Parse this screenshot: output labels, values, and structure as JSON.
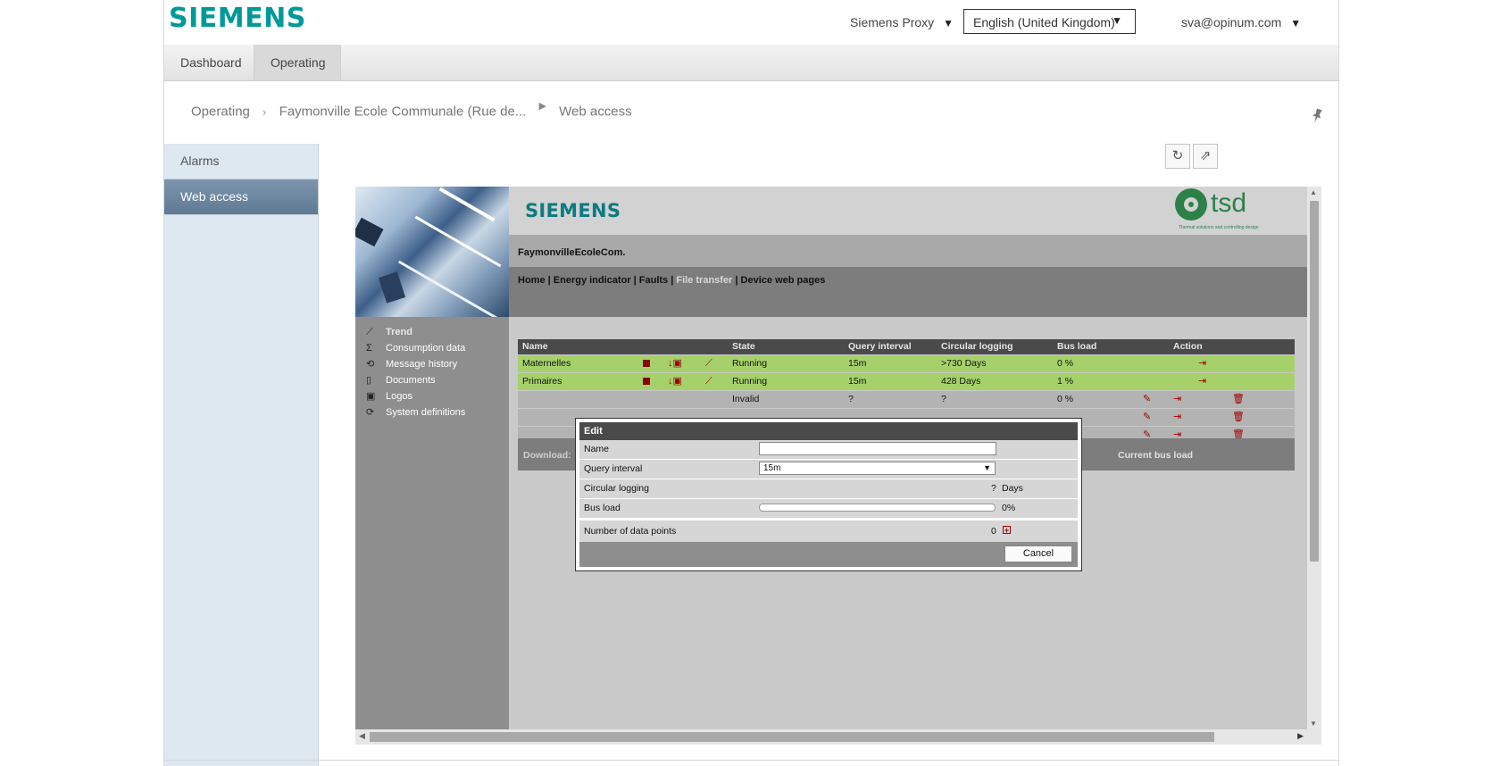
{
  "header": {
    "brand": "SIEMENS",
    "proxy": "Siemens Proxy",
    "language": "English (United Kingdom)",
    "user": "sva@opinum.com",
    "caret": "▼"
  },
  "tabs": [
    "Dashboard",
    "Operating"
  ],
  "breadcrumb": {
    "items": [
      "Operating",
      "Faymonville Ecole Communale (Rue de...",
      "Web access"
    ],
    "sep": "›",
    "play": "▶"
  },
  "sidebar": {
    "items": [
      "Alarms",
      "Web access"
    ],
    "active": "Web access"
  },
  "toolbar": {
    "refresh_icon": "↻",
    "share_icon": "⇗",
    "pin_icon": "📌"
  },
  "webpage": {
    "brand": "SIEMENS",
    "partner_logo": "tsd",
    "partner_tagline": "Thermal solutions and controlling design",
    "site": "FaymonvilleEcoleCom.",
    "menu": {
      "home": "Home",
      "energy": "Energy indicator",
      "faults": "Faults",
      "file_transfer": "File transfer",
      "device": "Device web pages",
      "sep": "|"
    },
    "nav": [
      {
        "icon": "trend-icon",
        "glyph": "⟋",
        "label": "Trend"
      },
      {
        "icon": "sigma-icon",
        "glyph": "Σ",
        "label": "Consumption data"
      },
      {
        "icon": "history-icon",
        "glyph": "⟲",
        "label": "Message history"
      },
      {
        "icon": "document-icon",
        "glyph": "▯",
        "label": "Documents"
      },
      {
        "icon": "image-icon",
        "glyph": "▣",
        "label": "Logos"
      },
      {
        "icon": "sync-icon",
        "glyph": "⟳",
        "label": "System definitions"
      }
    ],
    "table": {
      "headers": {
        "name": "Name",
        "state": "State",
        "query": "Query interval",
        "circular": "Circular logging",
        "bus": "Bus load",
        "action": "Action"
      },
      "rows": [
        {
          "name": "Maternelles",
          "state": "Running",
          "query": "15m",
          "circular": ">730 Days",
          "bus": "0 %"
        },
        {
          "name": "Primaires",
          "state": "Running",
          "query": "15m",
          "circular": "428 Days",
          "bus": "1 %"
        },
        {
          "name": "",
          "state": "Invalid",
          "query": "?",
          "circular": "?",
          "bus": "0 %"
        }
      ]
    },
    "download_label": "Download:",
    "current_bus_load": "Current bus load"
  },
  "dialog": {
    "title": "Edit",
    "name_label": "Name",
    "name_value": "",
    "query_label": "Query interval",
    "query_value": "15m",
    "circular_label": "Circular logging",
    "circular_value": "?",
    "circular_unit": "Days",
    "bus_label": "Bus load",
    "bus_value": "0%",
    "points_label": "Number of data points",
    "points_value": "0",
    "add_glyph": "+",
    "cancel": "Cancel"
  }
}
